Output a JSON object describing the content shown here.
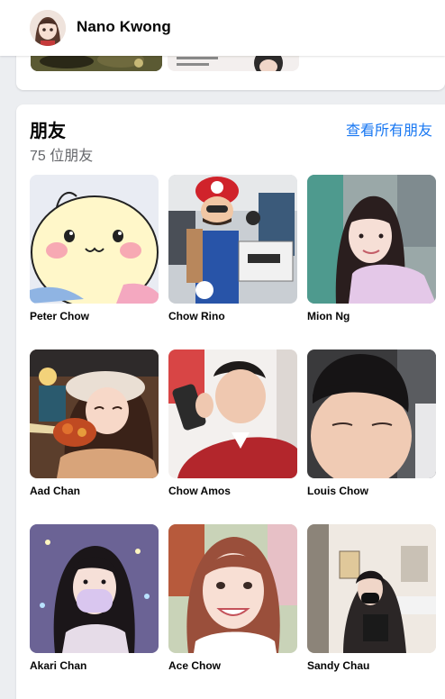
{
  "header": {
    "profile_name": "Nano Kwong"
  },
  "friends": {
    "title": "朋友",
    "count_text": "75 位朋友",
    "see_all_label": "查看所有朋友",
    "list": [
      {
        "name": "Peter Chow"
      },
      {
        "name": "Chow Rino"
      },
      {
        "name": "Mion Ng"
      },
      {
        "name": "Aad Chan"
      },
      {
        "name": "Chow Amos"
      },
      {
        "name": "Louis Chow"
      },
      {
        "name": "Akari Chan"
      },
      {
        "name": "Ace Chow"
      },
      {
        "name": "Sandy Chau"
      }
    ]
  }
}
